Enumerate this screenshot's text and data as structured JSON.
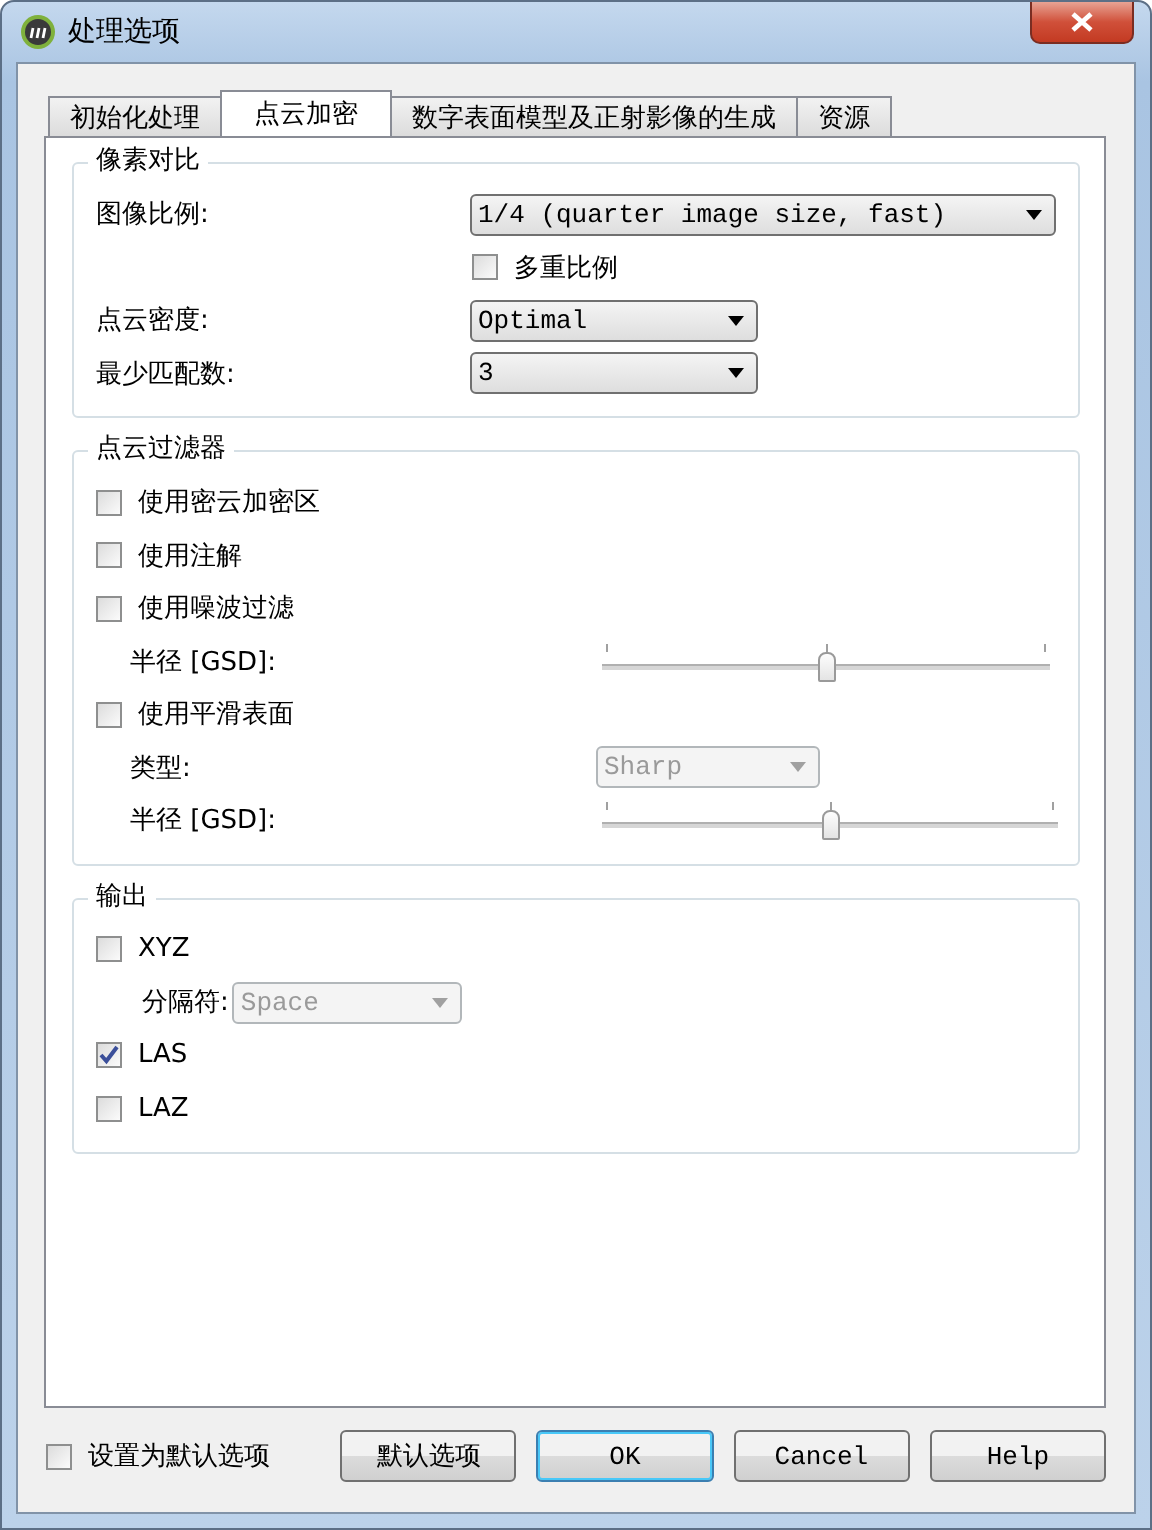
{
  "window": {
    "title": "处理选项"
  },
  "tabs": [
    {
      "label": "初始化处理",
      "selected": false
    },
    {
      "label": "点云加密",
      "selected": true
    },
    {
      "label": "数字表面模型及正射影像的生成",
      "selected": false
    },
    {
      "label": "资源",
      "selected": false
    }
  ],
  "sections": [
    {
      "title": "像素对比",
      "rows": [
        {
          "kind": "select",
          "label": "图像比例:",
          "value": "1/4 (quarter image size, fast)",
          "disabled": false
        },
        {
          "kind": "checkbox",
          "label": "多重比例",
          "checked": false
        },
        {
          "kind": "select",
          "label": "点云密度:",
          "value": "Optimal",
          "disabled": false
        },
        {
          "kind": "select",
          "label": "最少匹配数:",
          "value": "3",
          "disabled": false
        }
      ]
    },
    {
      "title": "点云过滤器",
      "rows": [
        {
          "kind": "checkbox",
          "label": "使用密云加密区",
          "checked": false
        },
        {
          "kind": "checkbox",
          "label": "使用注解",
          "checked": false
        },
        {
          "kind": "checkbox",
          "label": "使用噪波过滤",
          "checked": false
        },
        {
          "kind": "slider",
          "label": "半径 [GSD]:",
          "level": 0.5
        },
        {
          "kind": "checkbox",
          "label": "使用平滑表面",
          "checked": false
        },
        {
          "kind": "select",
          "label": "类型:",
          "value": "Sharp",
          "disabled": true
        },
        {
          "kind": "slider",
          "label": "半径 [GSD]:",
          "level": 0.5
        }
      ]
    },
    {
      "title": "输出",
      "rows": [
        {
          "kind": "checkbox",
          "label": "XYZ",
          "checked": false
        },
        {
          "kind": "select",
          "label": "分隔符:",
          "value": "Space",
          "disabled": true
        },
        {
          "kind": "checkbox",
          "label": "LAS",
          "checked": true
        },
        {
          "kind": "checkbox",
          "label": "LAZ",
          "checked": false
        }
      ]
    }
  ],
  "footer": {
    "checkbox": {
      "label": "设置为默认选项",
      "checked": false
    },
    "buttons": [
      {
        "label": "默认选项",
        "default": false
      },
      {
        "label": "OK",
        "default": true
      },
      {
        "label": "Cancel",
        "default": false
      },
      {
        "label": "Help",
        "default": false
      }
    ]
  }
}
